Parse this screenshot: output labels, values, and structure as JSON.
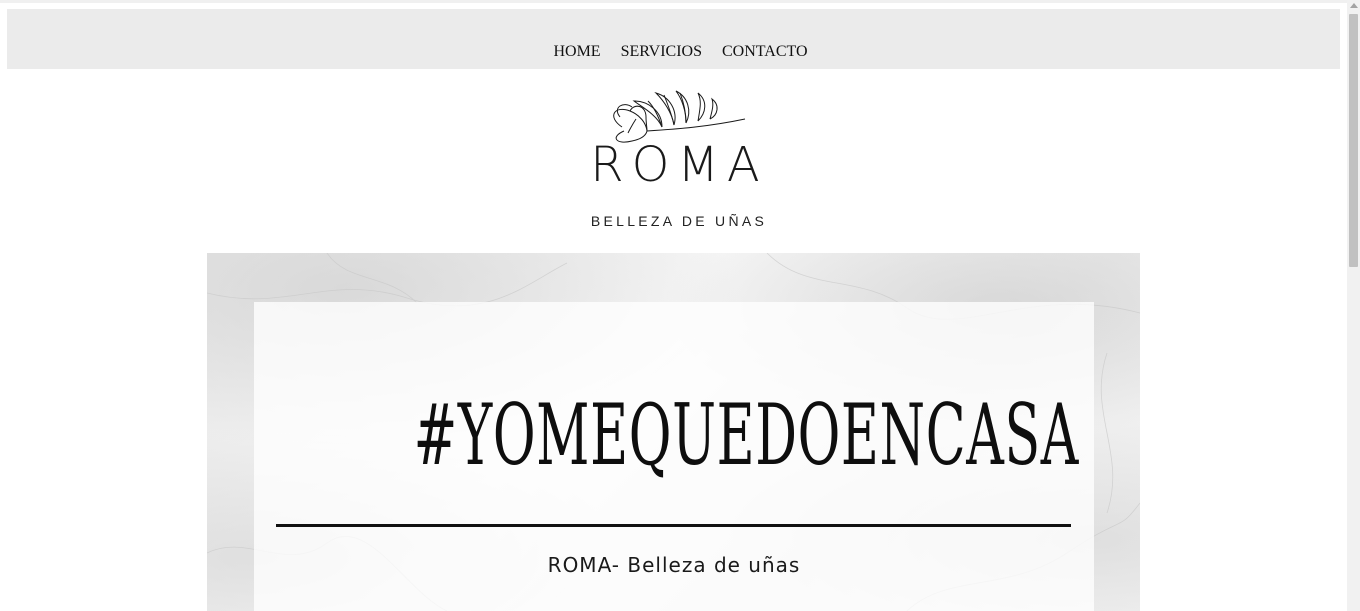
{
  "nav": {
    "items": [
      {
        "label": "HOME"
      },
      {
        "label": "SERVICIOS"
      },
      {
        "label": "CONTACTO"
      }
    ]
  },
  "logo": {
    "icon": "flower-branch-icon",
    "wordmark": "ROMA",
    "tagline": "BELLEZA DE UÑAS"
  },
  "hero": {
    "heading": "#YOMEQUEDOENCASA",
    "subtitle": "ROMA- Belleza de uñas"
  },
  "colors": {
    "nav_bg": "#ebebeb",
    "text": "#111111",
    "page_bg": "#ffffff",
    "scrollbar_thumb": "#c1c1c1"
  }
}
